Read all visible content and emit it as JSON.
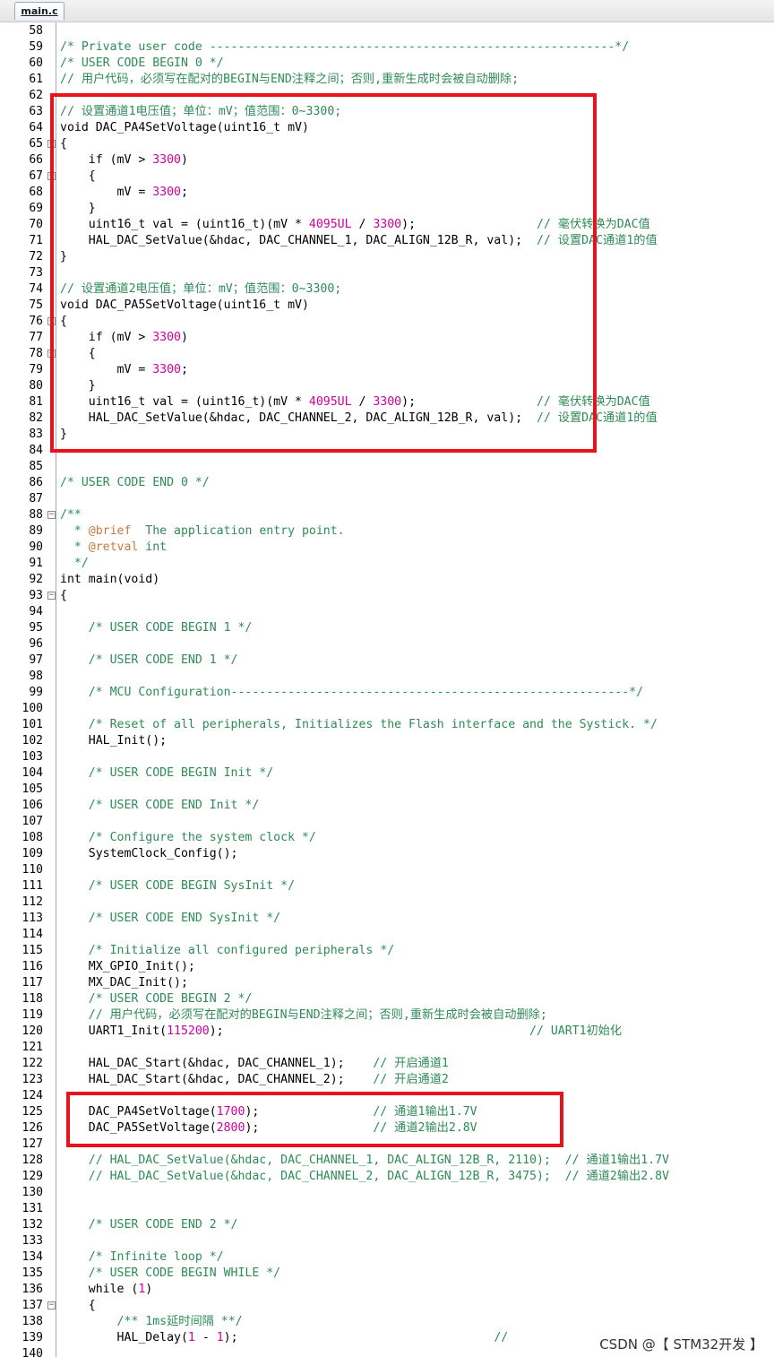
{
  "tab": {
    "label": "main.c"
  },
  "watermark": "CSDN @【 STM32开发 】",
  "lines": [
    {
      "n": "58",
      "t": [
        [
          "",
          ""
        ]
      ]
    },
    {
      "n": "59",
      "t": [
        [
          "c",
          "/* Private user code ---------------------------------------------------------*/"
        ]
      ]
    },
    {
      "n": "60",
      "t": [
        [
          "c",
          "/* USER CODE BEGIN 0 */"
        ]
      ]
    },
    {
      "n": "61",
      "t": [
        [
          "c",
          "// 用户代码，必须写在配对的BEGIN与END注释之间；否则,重新生成时会被自动删除;"
        ]
      ]
    },
    {
      "n": "62",
      "t": [
        [
          "",
          ""
        ]
      ]
    },
    {
      "n": "63",
      "t": [
        [
          "c",
          "// 设置通道1电压值；单位：mV；值范围：0~3300;"
        ]
      ]
    },
    {
      "n": "64",
      "t": [
        [
          "p",
          "void DAC_PA4SetVoltage(uint16_t mV)"
        ]
      ]
    },
    {
      "n": "65",
      "fold": true,
      "t": [
        [
          "p",
          "{"
        ]
      ]
    },
    {
      "n": "66",
      "t": [
        [
          "p",
          "    if (mV > "
        ],
        [
          "n",
          "3300"
        ],
        [
          "p",
          ")"
        ]
      ]
    },
    {
      "n": "67",
      "fold": true,
      "t": [
        [
          "p",
          "    {"
        ]
      ]
    },
    {
      "n": "68",
      "t": [
        [
          "p",
          "        mV = "
        ],
        [
          "n",
          "3300"
        ],
        [
          "p",
          ";"
        ]
      ]
    },
    {
      "n": "69",
      "t": [
        [
          "p",
          "    }"
        ]
      ]
    },
    {
      "n": "70",
      "t": [
        [
          "p",
          "    uint16_t val = (uint16_t)(mV * "
        ],
        [
          "n",
          "4095UL"
        ],
        [
          "p",
          " / "
        ],
        [
          "n",
          "3300"
        ],
        [
          "p",
          ");                 "
        ],
        [
          "c",
          "// 毫伏转换为DAC值"
        ]
      ]
    },
    {
      "n": "71",
      "t": [
        [
          "p",
          "    HAL_DAC_SetValue(&hdac, DAC_CHANNEL_1, DAC_ALIGN_12B_R, val);  "
        ],
        [
          "c",
          "// 设置DAC通道1的值"
        ]
      ]
    },
    {
      "n": "72",
      "t": [
        [
          "p",
          "}"
        ]
      ]
    },
    {
      "n": "73",
      "t": [
        [
          "",
          ""
        ]
      ]
    },
    {
      "n": "74",
      "t": [
        [
          "c",
          "// 设置通道2电压值；单位：mV；值范围：0~3300;"
        ]
      ]
    },
    {
      "n": "75",
      "t": [
        [
          "p",
          "void DAC_PA5SetVoltage(uint16_t mV)"
        ]
      ]
    },
    {
      "n": "76",
      "fold": true,
      "t": [
        [
          "p",
          "{"
        ]
      ]
    },
    {
      "n": "77",
      "t": [
        [
          "p",
          "    if (mV > "
        ],
        [
          "n",
          "3300"
        ],
        [
          "p",
          ")"
        ]
      ]
    },
    {
      "n": "78",
      "fold": true,
      "t": [
        [
          "p",
          "    {"
        ]
      ]
    },
    {
      "n": "79",
      "t": [
        [
          "p",
          "        mV = "
        ],
        [
          "n",
          "3300"
        ],
        [
          "p",
          ";"
        ]
      ]
    },
    {
      "n": "80",
      "t": [
        [
          "p",
          "    }"
        ]
      ]
    },
    {
      "n": "81",
      "t": [
        [
          "p",
          "    uint16_t val = (uint16_t)(mV * "
        ],
        [
          "n",
          "4095UL"
        ],
        [
          "p",
          " / "
        ],
        [
          "n",
          "3300"
        ],
        [
          "p",
          ");                 "
        ],
        [
          "c",
          "// 毫伏转换为DAC值"
        ]
      ]
    },
    {
      "n": "82",
      "t": [
        [
          "p",
          "    HAL_DAC_SetValue(&hdac, DAC_CHANNEL_2, DAC_ALIGN_12B_R, val);  "
        ],
        [
          "c",
          "// 设置DAC通道1的值"
        ]
      ]
    },
    {
      "n": "83",
      "t": [
        [
          "p",
          "}"
        ]
      ]
    },
    {
      "n": "84",
      "t": [
        [
          "",
          ""
        ]
      ]
    },
    {
      "n": "85",
      "t": [
        [
          "",
          ""
        ]
      ]
    },
    {
      "n": "86",
      "t": [
        [
          "c",
          "/* USER CODE END 0 */"
        ]
      ]
    },
    {
      "n": "87",
      "t": [
        [
          "",
          ""
        ]
      ]
    },
    {
      "n": "88",
      "fold": true,
      "t": [
        [
          "c",
          "/**"
        ]
      ]
    },
    {
      "n": "89",
      "t": [
        [
          "c",
          "  * "
        ],
        [
          "tag",
          "@brief"
        ],
        [
          "c",
          "  The application entry point."
        ]
      ]
    },
    {
      "n": "90",
      "t": [
        [
          "c",
          "  * "
        ],
        [
          "tag",
          "@retval"
        ],
        [
          "c",
          " int"
        ]
      ]
    },
    {
      "n": "91",
      "t": [
        [
          "c",
          "  */"
        ]
      ]
    },
    {
      "n": "92",
      "t": [
        [
          "p",
          "int main(void)"
        ]
      ]
    },
    {
      "n": "93",
      "fold": true,
      "t": [
        [
          "p",
          "{"
        ]
      ]
    },
    {
      "n": "94",
      "t": [
        [
          "",
          ""
        ]
      ]
    },
    {
      "n": "95",
      "t": [
        [
          "c",
          "    /* USER CODE BEGIN 1 */"
        ]
      ]
    },
    {
      "n": "96",
      "t": [
        [
          "",
          ""
        ]
      ]
    },
    {
      "n": "97",
      "t": [
        [
          "c",
          "    /* USER CODE END 1 */"
        ]
      ]
    },
    {
      "n": "98",
      "t": [
        [
          "",
          ""
        ]
      ]
    },
    {
      "n": "99",
      "t": [
        [
          "c",
          "    /* MCU Configuration--------------------------------------------------------*/"
        ]
      ]
    },
    {
      "n": "100",
      "t": [
        [
          "",
          ""
        ]
      ]
    },
    {
      "n": "101",
      "t": [
        [
          "c",
          "    /* Reset of all peripherals, Initializes the Flash interface and the Systick. */"
        ]
      ]
    },
    {
      "n": "102",
      "t": [
        [
          "p",
          "    HAL_Init();"
        ]
      ]
    },
    {
      "n": "103",
      "t": [
        [
          "",
          ""
        ]
      ]
    },
    {
      "n": "104",
      "t": [
        [
          "c",
          "    /* USER CODE BEGIN Init */"
        ]
      ]
    },
    {
      "n": "105",
      "t": [
        [
          "",
          ""
        ]
      ]
    },
    {
      "n": "106",
      "t": [
        [
          "c",
          "    /* USER CODE END Init */"
        ]
      ]
    },
    {
      "n": "107",
      "t": [
        [
          "",
          ""
        ]
      ]
    },
    {
      "n": "108",
      "t": [
        [
          "c",
          "    /* Configure the system clock */"
        ]
      ]
    },
    {
      "n": "109",
      "t": [
        [
          "p",
          "    SystemClock_Config();"
        ]
      ]
    },
    {
      "n": "110",
      "t": [
        [
          "",
          ""
        ]
      ]
    },
    {
      "n": "111",
      "t": [
        [
          "c",
          "    /* USER CODE BEGIN SysInit */"
        ]
      ]
    },
    {
      "n": "112",
      "t": [
        [
          "",
          ""
        ]
      ]
    },
    {
      "n": "113",
      "t": [
        [
          "c",
          "    /* USER CODE END SysInit */"
        ]
      ]
    },
    {
      "n": "114",
      "t": [
        [
          "",
          ""
        ]
      ]
    },
    {
      "n": "115",
      "t": [
        [
          "c",
          "    /* Initialize all configured peripherals */"
        ]
      ]
    },
    {
      "n": "116",
      "t": [
        [
          "p",
          "    MX_GPIO_Init();"
        ]
      ]
    },
    {
      "n": "117",
      "t": [
        [
          "p",
          "    MX_DAC_Init();"
        ]
      ]
    },
    {
      "n": "118",
      "t": [
        [
          "c",
          "    /* USER CODE BEGIN 2 */"
        ]
      ]
    },
    {
      "n": "119",
      "t": [
        [
          "c",
          "    // 用户代码，必须写在配对的BEGIN与END注释之间；否则,重新生成时会被自动删除;"
        ]
      ]
    },
    {
      "n": "120",
      "t": [
        [
          "p",
          "    UART1_Init("
        ],
        [
          "n",
          "115200"
        ],
        [
          "p",
          ");                                           "
        ],
        [
          "c",
          "// UART1初始化"
        ]
      ]
    },
    {
      "n": "121",
      "t": [
        [
          "",
          ""
        ]
      ]
    },
    {
      "n": "122",
      "t": [
        [
          "p",
          "    HAL_DAC_Start(&hdac, DAC_CHANNEL_1);    "
        ],
        [
          "c",
          "// 开启通道1"
        ]
      ]
    },
    {
      "n": "123",
      "t": [
        [
          "p",
          "    HAL_DAC_Start(&hdac, DAC_CHANNEL_2);    "
        ],
        [
          "c",
          "// 开启通道2"
        ]
      ]
    },
    {
      "n": "124",
      "t": [
        [
          "",
          ""
        ]
      ]
    },
    {
      "n": "125",
      "t": [
        [
          "p",
          "    DAC_PA4SetVoltage("
        ],
        [
          "n",
          "1700"
        ],
        [
          "p",
          ");                "
        ],
        [
          "c",
          "// 通道1输出1.7V"
        ]
      ]
    },
    {
      "n": "126",
      "t": [
        [
          "p",
          "    DAC_PA5SetVoltage("
        ],
        [
          "n",
          "2800"
        ],
        [
          "p",
          ");                "
        ],
        [
          "c",
          "// 通道2输出2.8V"
        ]
      ]
    },
    {
      "n": "127",
      "t": [
        [
          "",
          ""
        ]
      ]
    },
    {
      "n": "128",
      "t": [
        [
          "c",
          "    // HAL_DAC_SetValue(&hdac, DAC_CHANNEL_1, DAC_ALIGN_12B_R, 2110);  // 通道1输出1.7V"
        ]
      ]
    },
    {
      "n": "129",
      "t": [
        [
          "c",
          "    // HAL_DAC_SetValue(&hdac, DAC_CHANNEL_2, DAC_ALIGN_12B_R, 3475);  // 通道2输出2.8V"
        ]
      ]
    },
    {
      "n": "130",
      "t": [
        [
          "",
          ""
        ]
      ]
    },
    {
      "n": "131",
      "t": [
        [
          "",
          ""
        ]
      ]
    },
    {
      "n": "132",
      "t": [
        [
          "c",
          "    /* USER CODE END 2 */"
        ]
      ]
    },
    {
      "n": "133",
      "t": [
        [
          "",
          ""
        ]
      ]
    },
    {
      "n": "134",
      "t": [
        [
          "c",
          "    /* Infinite loop */"
        ]
      ]
    },
    {
      "n": "135",
      "t": [
        [
          "c",
          "    /* USER CODE BEGIN WHILE */"
        ]
      ]
    },
    {
      "n": "136",
      "t": [
        [
          "p",
          "    while ("
        ],
        [
          "n",
          "1"
        ],
        [
          "p",
          ")"
        ]
      ]
    },
    {
      "n": "137",
      "fold": true,
      "t": [
        [
          "p",
          "    {"
        ]
      ]
    },
    {
      "n": "138",
      "t": [
        [
          "c",
          "        /** 1ms延时间隔 **/"
        ]
      ]
    },
    {
      "n": "139",
      "t": [
        [
          "p",
          "        HAL_Delay("
        ],
        [
          "n",
          "1"
        ],
        [
          "p",
          " - "
        ],
        [
          "n",
          "1"
        ],
        [
          "p",
          ");                                    "
        ],
        [
          "c",
          "// "
        ]
      ]
    },
    {
      "n": "140",
      "t": [
        [
          "",
          ""
        ]
      ]
    }
  ],
  "colors": {
    "comment": "#2e8b57",
    "number": "#d1009c",
    "doc_tag": "#c8783c",
    "highlight_box": "#e8121c"
  }
}
